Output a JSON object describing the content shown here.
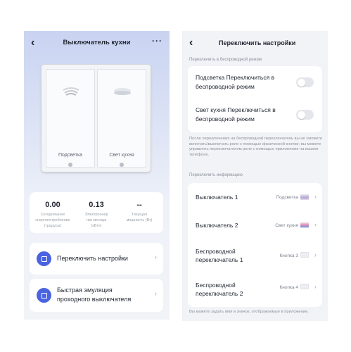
{
  "left_screen": {
    "title": "Выключатель кухни",
    "back_icon": "chevron-left-icon",
    "more_icon": "more-horizontal-icon",
    "gangs": [
      {
        "label": "Подсветка",
        "icon": "ceiling-light-icon"
      },
      {
        "label": "Свет кухня",
        "icon": "ceiling-light-icon"
      }
    ],
    "stats": [
      {
        "value": "0.00",
        "label": "Сегодняшнее энергопотребление (градусы)"
      },
      {
        "value": "0.13",
        "label": "Электроэнер гия месяца (кВтч)"
      },
      {
        "value": "--",
        "label": "Текущая мощность (Вт)"
      }
    ],
    "menu": [
      {
        "label": "Переключить настройки",
        "icon": "settings-square-icon"
      },
      {
        "label": "Быстрая эмуляция проходного выключателя",
        "icon": "switch-panel-icon"
      }
    ],
    "accent_color": "#4a63e0"
  },
  "right_screen": {
    "title": "Переключить настройки",
    "back_icon": "chevron-left-icon",
    "wireless_section_label": "Переключить в беспроводной режим",
    "toggles": [
      {
        "label": "Подсветка Переключиться в беспроводной режим",
        "on": false
      },
      {
        "label": "Свет кухня Переключиться в беспроводной режим",
        "on": false
      }
    ],
    "wireless_note": "После переключения на беспроводной переключатель вы не сможете включать/выключать реле с помощью физической кнопки; вы можете управлять переключателем реле с помощью приложения на вашем телефоне.",
    "info_section_label": "Переключить информацию",
    "info_rows": [
      {
        "name": "Выключатель 1",
        "value": "Подсветка"
      },
      {
        "name": "Выключатель 2",
        "value": "Свет кухня"
      },
      {
        "name": "Беспроводной переключатель 1",
        "value": "Кнопка 3"
      },
      {
        "name": "Беспроводной переключатель 2",
        "value": "Кнопка 4"
      }
    ],
    "footer_note": "Вы можете задать имя и значок, отображаемые в приложении."
  }
}
